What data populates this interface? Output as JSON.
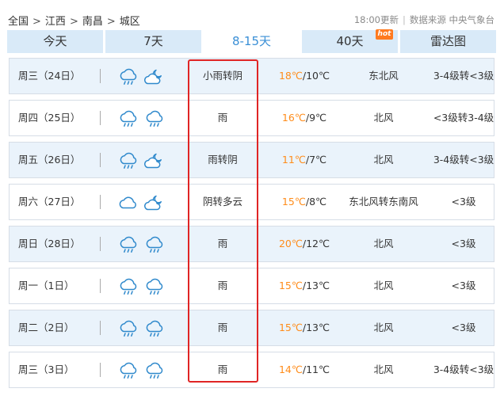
{
  "breadcrumb": {
    "level1": "全国",
    "level2": "江西",
    "level3": "南昌",
    "level4": "城区",
    "sep": ">"
  },
  "meta": {
    "updated": "18:00更新",
    "divider": "|",
    "source": "数据来源 中央气象台"
  },
  "tabs": [
    {
      "label": "今天"
    },
    {
      "label": "7天"
    },
    {
      "label": "8-15天"
    },
    {
      "label": "40天",
      "badge": "hot"
    },
    {
      "label": "雷达图"
    }
  ],
  "active_tab": "8-15天",
  "colors": {
    "tab_bg": "#d9eaf8",
    "active_tab_text": "#3a8fd6",
    "high_temp": "#ff8c1a",
    "row_alt": "#eaf3fb",
    "highlight": "#e02525",
    "badge": "#ff7a1f"
  },
  "forecast": [
    {
      "date": "周三（24日）",
      "icon1": "rain-cloud-icon",
      "icon2": "cloudy-night-icon",
      "desc": "小雨转阴",
      "hi": "18℃",
      "lo": "/10℃",
      "wind": "东北风",
      "level": "3-4级转<3级"
    },
    {
      "date": "周四（25日）",
      "icon1": "rain-cloud-icon",
      "icon2": "rain-cloud-icon",
      "desc": "雨",
      "hi": "16℃",
      "lo": "/9℃",
      "wind": "北风",
      "level": "<3级转3-4级"
    },
    {
      "date": "周五（26日）",
      "icon1": "rain-cloud-icon",
      "icon2": "cloudy-night-icon",
      "desc": "雨转阴",
      "hi": "11℃",
      "lo": "/7℃",
      "wind": "北风",
      "level": "3-4级转<3级"
    },
    {
      "date": "周六（27日）",
      "icon1": "cloud-icon",
      "icon2": "cloudy-night-icon",
      "desc": "阴转多云",
      "hi": "15℃",
      "lo": "/8℃",
      "wind": "东北风转东南风",
      "level": "<3级"
    },
    {
      "date": "周日（28日）",
      "icon1": "rain-cloud-icon",
      "icon2": "rain-cloud-icon",
      "desc": "雨",
      "hi": "20℃",
      "lo": "/12℃",
      "wind": "北风",
      "level": "<3级"
    },
    {
      "date": "周一（1日）",
      "icon1": "rain-cloud-icon",
      "icon2": "rain-cloud-icon",
      "desc": "雨",
      "hi": "15℃",
      "lo": "/13℃",
      "wind": "北风",
      "level": "<3级"
    },
    {
      "date": "周二（2日）",
      "icon1": "rain-cloud-icon",
      "icon2": "rain-cloud-icon",
      "desc": "雨",
      "hi": "15℃",
      "lo": "/13℃",
      "wind": "北风",
      "level": "<3级"
    },
    {
      "date": "周三（3日）",
      "icon1": "rain-cloud-icon",
      "icon2": "rain-cloud-icon",
      "desc": "雨",
      "hi": "14℃",
      "lo": "/11℃",
      "wind": "北风",
      "level": "3-4级转<3级"
    }
  ]
}
